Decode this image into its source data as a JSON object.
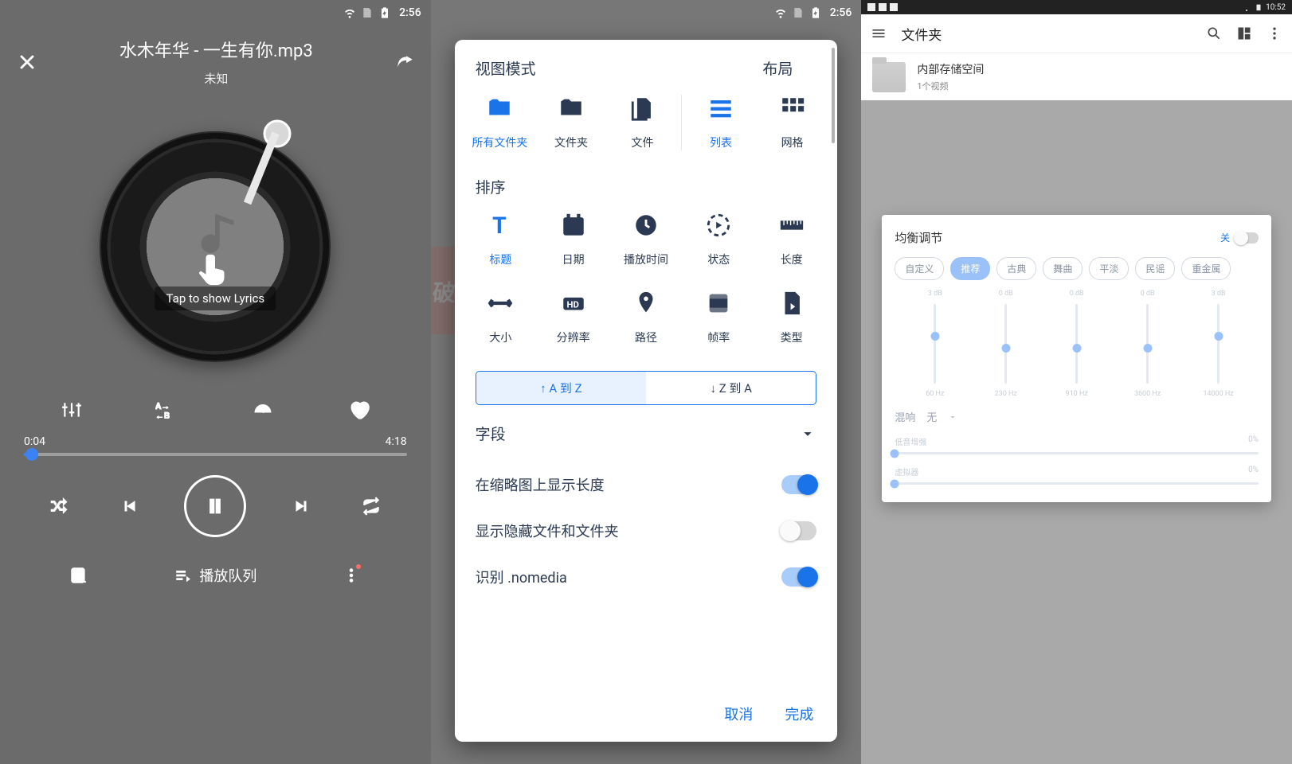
{
  "status": {
    "time12": "2:56",
    "time3": "10:52"
  },
  "player": {
    "title": "水木年华 - 一生有你.mp3",
    "subtitle": "未知",
    "lyrics_hint": "Tap to show Lyrics",
    "elapsed": "0:04",
    "total": "4:18",
    "queue_label": "播放队列"
  },
  "dialog": {
    "view_mode": "视图模式",
    "layout": "布局",
    "tiles": {
      "all_folders": "所有文件夹",
      "folders": "文件夹",
      "files": "文件",
      "list": "列表",
      "grid": "网格"
    },
    "sort": "排序",
    "sort_keys": {
      "title": "标题",
      "date": "日期",
      "playtime": "播放时间",
      "state": "状态",
      "length": "长度",
      "size": "大小",
      "resolution": "分辨率",
      "path": "路径",
      "fps": "帧率",
      "type": "类型"
    },
    "order_asc": "↑  A 到 Z",
    "order_desc": "↓  Z 到 A",
    "fields": "字段",
    "show_len": "在缩略图上显示长度",
    "show_hidden": "显示隐藏文件和文件夹",
    "respect_nomedia": "识别 .nomedia",
    "cancel": "取消",
    "done": "完成"
  },
  "panel3": {
    "appbar_title": "文件夹",
    "folder_name": "内部存储空间",
    "folder_sub": "1个视频",
    "eq_title": "均衡调节",
    "eq_off": "关",
    "presets": [
      "自定义",
      "推荐",
      "古典",
      "舞曲",
      "平淡",
      "民谣",
      "重金属"
    ],
    "bands": [
      {
        "db": "3 dB",
        "hz": "60 Hz",
        "pos": 35
      },
      {
        "db": "0 dB",
        "hz": "230 Hz",
        "pos": 50
      },
      {
        "db": "0 dB",
        "hz": "910 Hz",
        "pos": 50
      },
      {
        "db": "0 dB",
        "hz": "3600 Hz",
        "pos": 50
      },
      {
        "db": "3 dB",
        "hz": "14000 Hz",
        "pos": 35
      }
    ],
    "reverb_label": "混响",
    "reverb_value": "无",
    "bass_label": "低音增强",
    "bass_val": "0%",
    "vir_label": "虚拟器",
    "vir_val": "0%"
  }
}
